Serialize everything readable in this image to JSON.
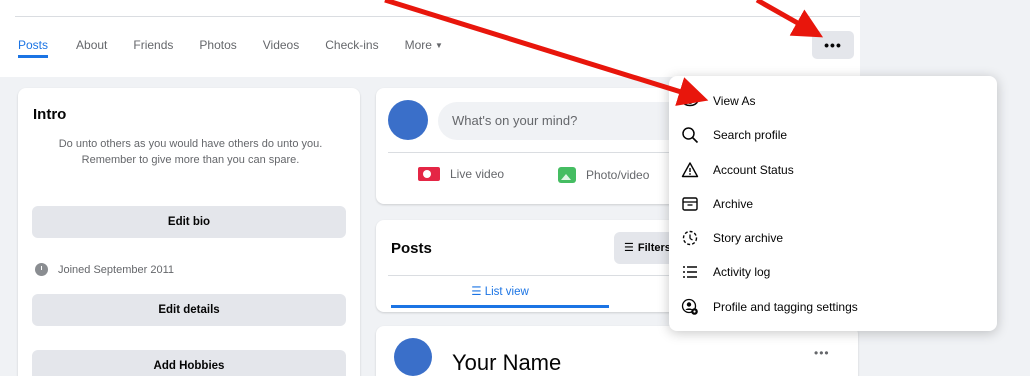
{
  "nav": {
    "tabs": [
      {
        "label": "Posts",
        "active": true
      },
      {
        "label": "About"
      },
      {
        "label": "Friends"
      },
      {
        "label": "Photos"
      },
      {
        "label": "Videos"
      },
      {
        "label": "Check-ins"
      },
      {
        "label": "More"
      }
    ],
    "more_options_label": "•••"
  },
  "intro": {
    "title": "Intro",
    "bio": "Do unto others as you would have others do unto you. Remember to give more than you can spare.",
    "edit_bio_label": "Edit bio",
    "joined_text": "Joined September 2011",
    "edit_details_label": "Edit details",
    "add_hobbies_label": "Add Hobbies"
  },
  "composer": {
    "placeholder": "What's on your mind?",
    "live_video_label": "Live video",
    "photo_video_label": "Photo/video"
  },
  "posts": {
    "title": "Posts",
    "filters_label": "Filters",
    "list_view_label": "List view"
  },
  "post": {
    "author": "Your Name",
    "options_label": "•••"
  },
  "menu": {
    "items": [
      {
        "label": "View As",
        "icon": "eye-icon"
      },
      {
        "label": "Search profile",
        "icon": "search-icon"
      },
      {
        "label": "Account Status",
        "icon": "warning-icon"
      },
      {
        "label": "Archive",
        "icon": "archive-icon"
      },
      {
        "label": "Story archive",
        "icon": "story-archive-icon"
      },
      {
        "label": "Activity log",
        "icon": "activity-log-icon"
      },
      {
        "label": "Profile and tagging settings",
        "icon": "profile-settings-icon"
      }
    ]
  },
  "colors": {
    "accent": "#1b74e4",
    "annotation_arrow": "#e8160c",
    "avatar": "#3a6fc9"
  }
}
